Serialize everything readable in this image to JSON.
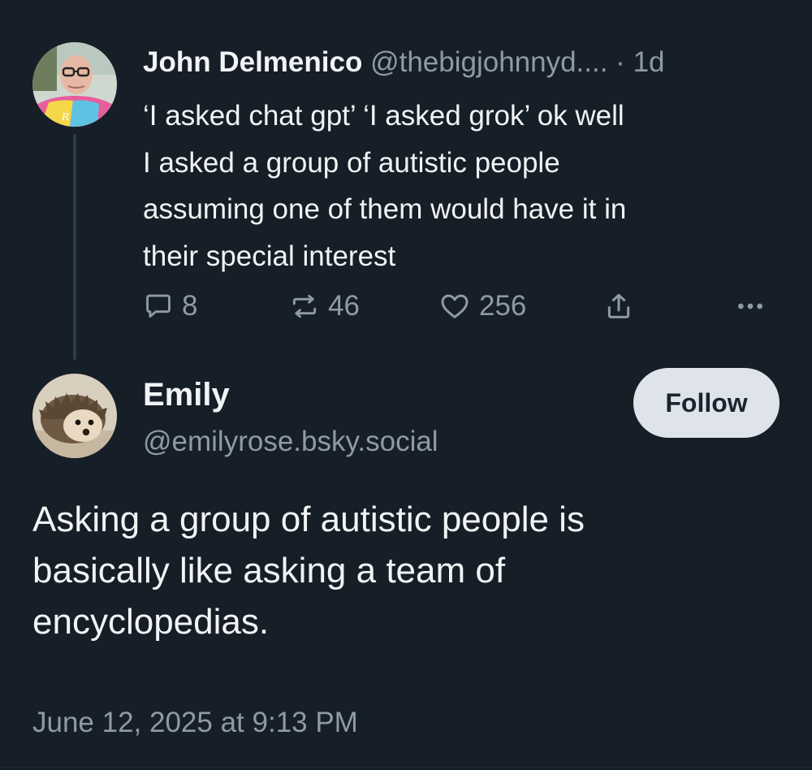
{
  "parent_post": {
    "author_name": "John Delmenico",
    "author_handle": "@thebigjohnnyd....",
    "separator": " · ",
    "age": "1d",
    "text": "‘I asked chat gpt’ ‘I asked grok’ ok well\nI asked a group of autistic people\nassuming one of them would have it in\ntheir special interest",
    "reply_count": "8",
    "repost_count": "46",
    "like_count": "256"
  },
  "main_post": {
    "author_name": "Emily",
    "author_handle": "@emilyrose.bsky.social",
    "follow_label": "Follow",
    "text": "Asking a group of autistic people is\nbasically like asking a team of\nencyclopedias.",
    "timestamp": "June 12, 2025 at 9:13 PM"
  },
  "colors": {
    "background": "#161e27",
    "text_primary": "#f1f3f5",
    "text_secondary": "#8f9aa7",
    "thread_line": "#2e3a47",
    "follow_button_bg": "#dfe4ea"
  },
  "icons": {
    "reply": "reply-bubble-icon",
    "repost": "repost-icon",
    "like": "heart-icon",
    "share": "share-icon",
    "more": "more-options-icon"
  }
}
